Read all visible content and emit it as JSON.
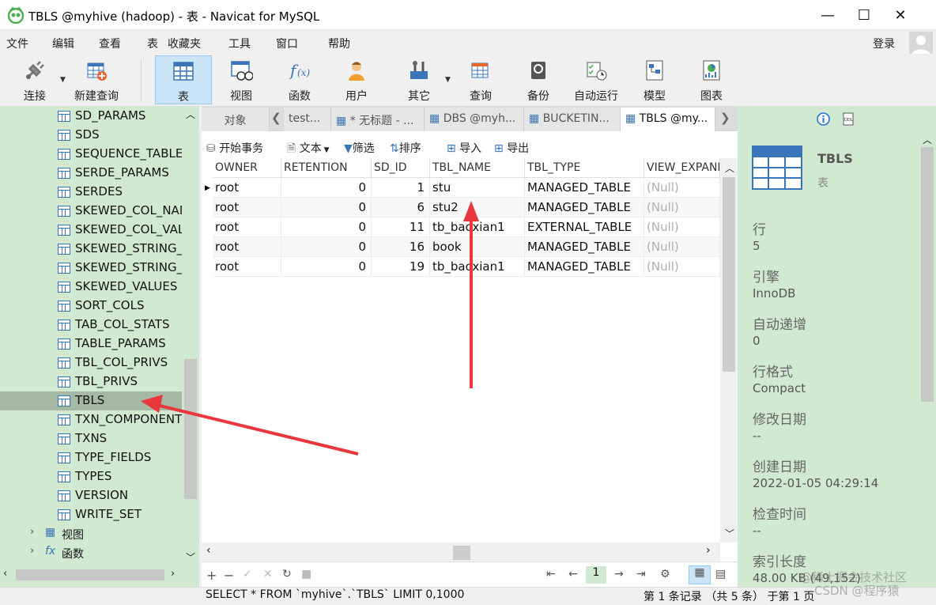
{
  "window": {
    "title": "TBLS @myhive (hadoop) - 表 - Navicat for MySQL",
    "minimize": "—",
    "maximize": "☐",
    "close": "✕"
  },
  "menu": {
    "items": [
      "文件",
      "编辑",
      "查看",
      "表",
      "收藏夹",
      "工具",
      "窗口",
      "帮助"
    ],
    "login": "登录"
  },
  "toolbar": {
    "items": [
      "连接",
      "新建查询",
      "表",
      "视图",
      "函数",
      "用户",
      "其它",
      "查询",
      "备份",
      "自动运行",
      "模型",
      "图表"
    ],
    "active": "表"
  },
  "tree": {
    "items": [
      "SD_PARAMS",
      "SDS",
      "SEQUENCE_TABLE",
      "SERDE_PARAMS",
      "SERDES",
      "SKEWED_COL_NAMES",
      "SKEWED_COL_VALUE_LOC_MAP",
      "SKEWED_STRING_LIST",
      "SKEWED_STRING_LIST_VALUES",
      "SKEWED_VALUES",
      "SORT_COLS",
      "TAB_COL_STATS",
      "TABLE_PARAMS",
      "TBL_COL_PRIVS",
      "TBL_PRIVS",
      "TBLS",
      "TXN_COMPONENTS",
      "TXNS",
      "TYPE_FIELDS",
      "TYPES",
      "VERSION",
      "WRITE_SET"
    ],
    "selected": "TBLS",
    "groups": [
      {
        "label": "视图",
        "icon": "view-group-icon"
      },
      {
        "label": "函数",
        "icon": "function-group-icon"
      }
    ]
  },
  "tabs": [
    "对象",
    "test...",
    "* 无标题 - ...",
    "DBS @myh...",
    "BUCKETIN...",
    "TBLS @my..."
  ],
  "content_toolbar": {
    "begin_transaction": "开始事务",
    "text": "文本",
    "filter": "筛选",
    "sort": "排序",
    "import": "导入",
    "export": "导出"
  },
  "table": {
    "columns": [
      "OWNER",
      "RETENTION",
      "SD_ID",
      "TBL_NAME",
      "TBL_TYPE",
      "VIEW_EXPANDED_TEXT"
    ],
    "rows": [
      [
        "root",
        "0",
        "1",
        "stu",
        "MANAGED_TABLE",
        "(Null)"
      ],
      [
        "root",
        "0",
        "6",
        "stu2",
        "MANAGED_TABLE",
        "(Null)"
      ],
      [
        "root",
        "0",
        "11",
        "tb_baoxian1",
        "EXTERNAL_TABLE",
        "(Null)"
      ],
      [
        "root",
        "0",
        "16",
        "book",
        "MANAGED_TABLE",
        "(Null)"
      ],
      [
        "root",
        "0",
        "19",
        "tb_baoxian1",
        "MANAGED_TABLE",
        "(Null)"
      ]
    ]
  },
  "pager": {
    "current_page": "1"
  },
  "info": {
    "name": "TBLS",
    "type": "表",
    "props": [
      {
        "key": "行",
        "value": "5"
      },
      {
        "key": "引擎",
        "value": "InnoDB"
      },
      {
        "key": "自动递增",
        "value": "0"
      },
      {
        "key": "行格式",
        "value": "Compact"
      },
      {
        "key": "修改日期",
        "value": "--"
      },
      {
        "key": "创建日期",
        "value": "2022-01-05 04:29:14"
      },
      {
        "key": "检查时间",
        "value": "--"
      },
      {
        "key": "索引长度",
        "value": "48.00 KB (49,152)"
      }
    ]
  },
  "status": {
    "sql": "SELECT * FROM `myhive`.`TBLS` LIMIT 0,1000",
    "records": "第 1 条记录 （共 5 条） 于第 1 页"
  },
  "watermark": "CSDN @程序猿",
  "watermark2": "@稀土掘金技术社区",
  "colors": {
    "pane_green": "#d2e9d1",
    "selected_row": "#a4b8a4",
    "arrow_red": "#e8383d",
    "active_tool": "#cce4f7"
  }
}
